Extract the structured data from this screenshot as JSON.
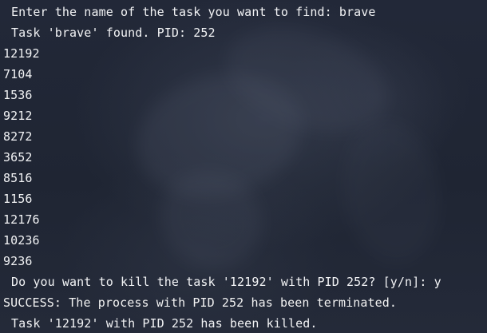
{
  "terminal": {
    "lines": [
      "Enter the name of the task you want to find: brave",
      "Task 'brave' found. PID: 252",
      "12192",
      "7104",
      "1536",
      "9212",
      "8272",
      "3652",
      "8516",
      "1156",
      "12176",
      "10236",
      "9236",
      "Do you want to kill the task '12192' with PID 252? [y/n]: y",
      "SUCCESS: The process with PID 252 has been terminated.",
      "Task '12192' with PID 252 has been killed."
    ]
  }
}
